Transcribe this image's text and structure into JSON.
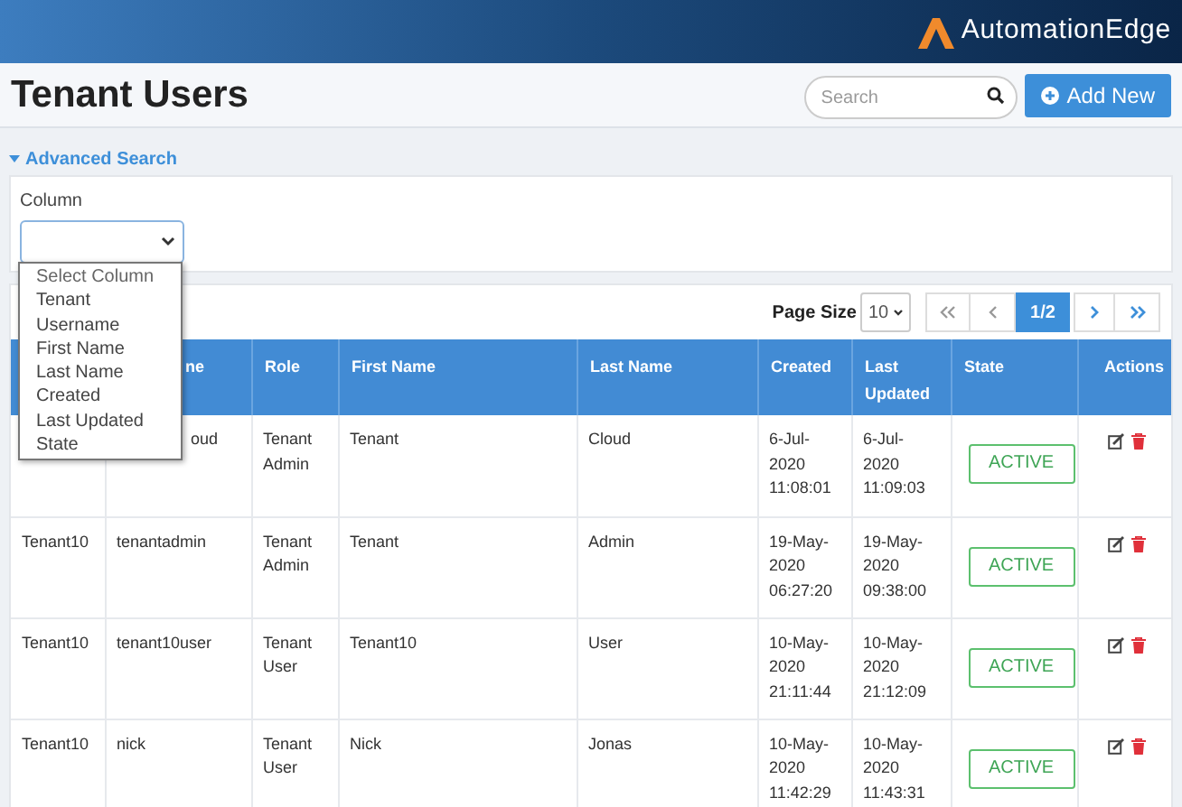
{
  "brand": {
    "name": "AutomationEdge"
  },
  "page": {
    "title": "Tenant Users"
  },
  "search": {
    "placeholder": "Search"
  },
  "add_button": {
    "label": "Add New"
  },
  "advanced_search": {
    "label": "Advanced Search",
    "expanded": true,
    "column_label": "Column",
    "column_options": [
      "Select Column",
      "Tenant",
      "Username",
      "First Name",
      "Last Name",
      "Created",
      "Last Updated",
      "State"
    ]
  },
  "pagination": {
    "page_size_label": "Page Size",
    "page_size": "10",
    "current": "1/2"
  },
  "table": {
    "columns": [
      "",
      "ne",
      "Role",
      "First Name",
      "Last Name",
      "Created",
      "Last Updated",
      "State",
      "Actions"
    ],
    "rows": [
      {
        "cells": [
          "",
          "oud",
          "Tenant Admin",
          "Tenant",
          "Cloud",
          "6-Jul-2020 11:08:01",
          "6-Jul-2020 11:09:03"
        ],
        "state": "ACTIVE"
      },
      {
        "cells": [
          "Tenant10",
          "tenantadmin",
          "Tenant Admin",
          "Tenant",
          "Admin",
          "19-May-2020 06:27:20",
          "19-May-2020 09:38:00"
        ],
        "state": "ACTIVE"
      },
      {
        "cells": [
          "Tenant10",
          "tenant10user",
          "Tenant User",
          "Tenant10",
          "User",
          "10-May-2020 21:11:44",
          "10-May-2020 21:12:09"
        ],
        "state": "ACTIVE"
      },
      {
        "cells": [
          "Tenant10",
          "nick",
          "Tenant User",
          "Nick",
          "Jonas",
          "10-May-2020 11:42:29",
          "10-May-2020 11:43:31"
        ],
        "state": "ACTIVE"
      }
    ]
  }
}
